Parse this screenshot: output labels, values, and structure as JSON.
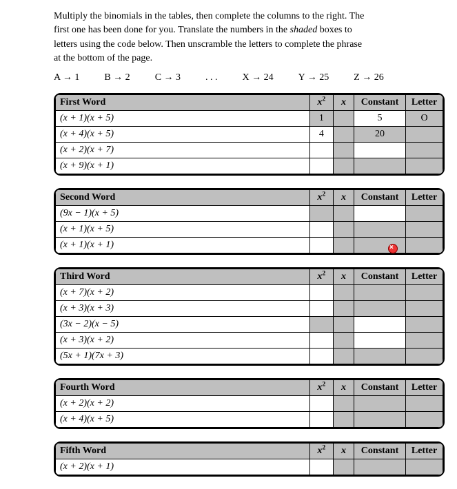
{
  "intro_l1": "Multiply the binomials in the tables, then complete the columns to the right. The",
  "intro_l2a": "first one has been done for you. Translate the numbers in the ",
  "intro_l2b": "shaded",
  "intro_l2c": " boxes to",
  "intro_l3": "letters using the code below. Then unscramble the letters to complete the phrase",
  "intro_l4": "at the bottom of the page.",
  "code": {
    "a": "A → 1",
    "b": "B → 2",
    "c": "C → 3",
    "dots": ". . .",
    "x": "X → 24",
    "y": "Y → 25",
    "z": "Z → 26"
  },
  "hdr": {
    "x2": "x²",
    "x": "x",
    "const": "Constant",
    "letter": "Letter"
  },
  "words": [
    {
      "title": "First Word",
      "rows": [
        {
          "e": "(x + 1)(x + 5)",
          "x2": "1",
          "xv": "",
          "c": "5",
          "l": "O",
          "sx2": true,
          "sc": false
        },
        {
          "e": "(x + 4)(x + 5)",
          "x2": "4",
          "xv": "",
          "c": "20",
          "l": "",
          "sx2": false,
          "sc": true
        },
        {
          "e": "(x + 2)(x + 7)",
          "x2": "",
          "xv": "",
          "c": "",
          "l": "",
          "sx2": false,
          "sc": false
        },
        {
          "e": "(x + 9)(x + 1)",
          "x2": "",
          "xv": "",
          "c": "",
          "l": "",
          "sx2": false,
          "sc": true
        }
      ]
    },
    {
      "title": "Second Word",
      "rows": [
        {
          "e": "(9x − 1)(x + 5)",
          "x2": "",
          "xv": "",
          "c": "",
          "l": "",
          "sx2": true,
          "sc": false
        },
        {
          "e": "(x + 1)(x + 5)",
          "x2": "",
          "xv": "",
          "c": "",
          "l": "",
          "sx2": false,
          "sc": true
        },
        {
          "e": "(x + 1)(x + 1)",
          "x2": "",
          "xv": "",
          "c": "",
          "l": "",
          "sx2": false,
          "sc": true
        }
      ],
      "marker": true
    },
    {
      "title": "Third Word",
      "rows": [
        {
          "e": "(x + 7)(x + 2)",
          "x2": "",
          "xv": "",
          "c": "",
          "l": "",
          "sx2": false,
          "sc": true
        },
        {
          "e": "(x + 3)(x + 3)",
          "x2": "",
          "xv": "",
          "c": "",
          "l": "",
          "sx2": false,
          "sc": true
        },
        {
          "e": "(3x − 2)(x − 5)",
          "x2": "",
          "xv": "",
          "c": "",
          "l": "",
          "sx2": true,
          "sc": false
        },
        {
          "e": "(x + 3)(x + 2)",
          "x2": "",
          "xv": "",
          "c": "",
          "l": "",
          "sx2": false,
          "sc": false
        },
        {
          "e": "(5x + 1)(7x + 3)",
          "x2": "",
          "xv": "",
          "c": "",
          "l": "",
          "sx2": false,
          "sc": true
        }
      ]
    },
    {
      "title": "Fourth Word",
      "rows": [
        {
          "e": "(x + 2)(x + 2)",
          "x2": "",
          "xv": "",
          "c": "",
          "l": "",
          "sx2": false,
          "sc": true
        },
        {
          "e": "(x + 4)(x + 5)",
          "x2": "",
          "xv": "",
          "c": "",
          "l": "",
          "sx2": false,
          "sc": true
        }
      ]
    },
    {
      "title": "Fifth Word",
      "rows": [
        {
          "e": "(x + 2)(x + 1)",
          "x2": "",
          "xv": "",
          "c": "",
          "l": "",
          "sx2": false,
          "sc": true
        }
      ]
    }
  ]
}
